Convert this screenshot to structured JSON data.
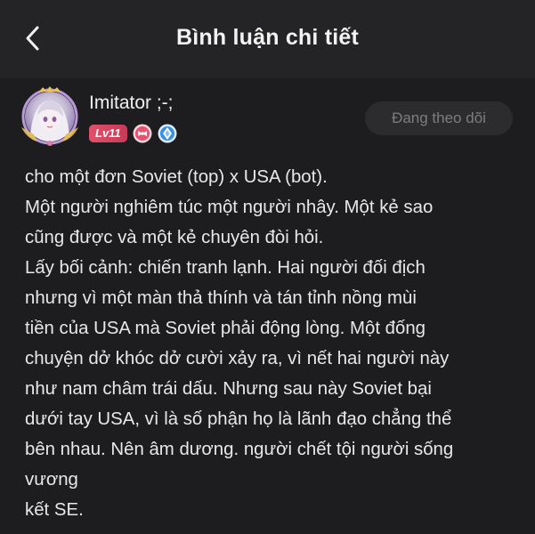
{
  "header": {
    "title": "Bình luận chi tiết",
    "back_icon": "chevron-left-icon"
  },
  "user": {
    "name": "Imitator ;-;",
    "level": "Lv11",
    "avatar": "anime-girl-avatar",
    "badges": [
      "pink-ribbon-badge-icon",
      "blue-diamond-badge-icon"
    ]
  },
  "follow_button": {
    "label": "Đang theo dõi"
  },
  "comment": {
    "lines": [
      "cho một đơn Soviet (top) x USA (bot).",
      "Một người nghiêm túc một người nhây. Một kẻ sao",
      "cũng được và một kẻ chuyên đòi hỏi.",
      "Lấy bối cảnh: chiến tranh lạnh. Hai người đối địch",
      "nhưng vì một màn thả thính và tán tỉnh nồng mùi",
      "tiền của USA mà Soviet phải động lòng. Một đống",
      "chuyện dở khóc dở cười xảy ra, vì nết hai người này",
      "như nam châm trái dấu. Nhưng sau này Soviet bại",
      "dưới tay USA, vì là số phận họ là lãnh đạo chẳng thể",
      "bên nhau. Nên âm dương. người chết tội người sống",
      "vương",
      "kết SE."
    ]
  },
  "colors": {
    "background": "#1d1d1f",
    "header_bg": "#242426",
    "level_badge": "#d9475f",
    "follow_text": "#7d7d80"
  }
}
